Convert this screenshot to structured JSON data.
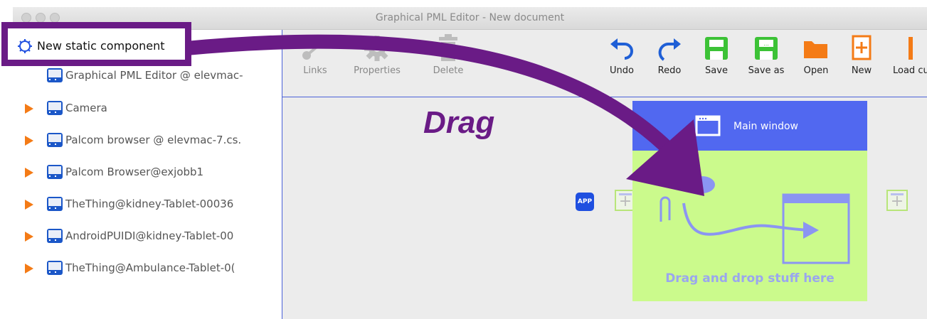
{
  "window": {
    "title": "Graphical PML Editor - New document"
  },
  "callout": {
    "label": "New static component"
  },
  "annotation": {
    "drag_label": "Drag"
  },
  "sidebar": {
    "items": [
      {
        "label": "Graphical PML Editor @ elevmac-",
        "expandable": false
      },
      {
        "label": "Camera",
        "expandable": true
      },
      {
        "label": "Palcom browser @ elevmac-7.cs.",
        "expandable": true
      },
      {
        "label": "Palcom Browser@exjobb1",
        "expandable": true
      },
      {
        "label": "TheThing@kidney-Tablet-00036",
        "expandable": true
      },
      {
        "label": "AndroidPUIDI@kidney-Tablet-00",
        "expandable": true
      },
      {
        "label": "TheThing@Ambulance-Tablet-0(",
        "expandable": true
      }
    ]
  },
  "toolbar": {
    "links": "Links",
    "properties": "Properties",
    "delete": "Delete",
    "undo": "Undo",
    "redo": "Redo",
    "save": "Save",
    "save_as": "Save as",
    "open": "Open",
    "new": "New",
    "load": "Load cu"
  },
  "canvas": {
    "main_window_title": "Main window",
    "drop_hint": "Drag and drop stuff here",
    "app_badge": "APP"
  },
  "colors": {
    "accent_purple": "#6a1b86",
    "main_window_header": "#5168f0",
    "main_window_body": "#cbfa8c",
    "tree_arrow": "#f47b16",
    "device_icon": "#1b57c8",
    "save_green": "#3cc236",
    "undo_blue": "#1f5fd6",
    "open_orange": "#f47b16"
  }
}
